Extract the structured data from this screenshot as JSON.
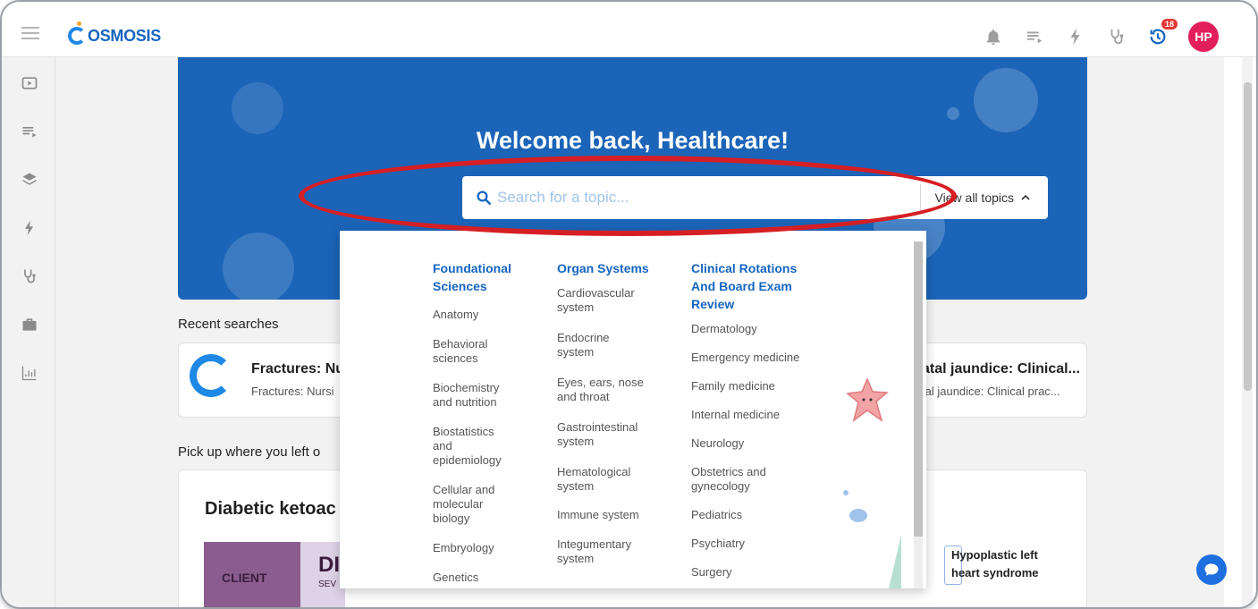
{
  "app": {
    "brand": "OSMOSIS",
    "user_initials": "HP",
    "history_badge": "18"
  },
  "hero": {
    "title": "Welcome back, Healthcare!",
    "search_placeholder": "Search for a topic...",
    "view_all_label": "View all topics"
  },
  "recent": {
    "label": "Recent searches",
    "items": [
      {
        "title": "Fractures: Nu",
        "subtitle": "Fractures: Nursi"
      },
      {
        "title": "atal jaundice: Clinical...",
        "subtitle": "tal jaundice: Clinical prac..."
      }
    ]
  },
  "continue": {
    "label": "Pick up where you left o",
    "card_title": "Diabetic ketoac",
    "side_title_line1": "Hypoplastic left",
    "side_title_line2": "heart syndrome",
    "thumb_text1": "CLIENT",
    "thumb_text2": "DI",
    "thumb_text3": "SEV"
  },
  "topics": {
    "columns": [
      {
        "heading_lines": [
          "Foundational",
          "Sciences"
        ],
        "items": [
          [
            "Anatomy"
          ],
          [
            "Behavioral",
            "sciences"
          ],
          [
            "Biochemistry",
            "and nutrition"
          ],
          [
            "Biostatistics",
            "and",
            "epidemiology"
          ],
          [
            "Cellular and",
            "molecular",
            "biology"
          ],
          [
            "Embryology"
          ],
          [
            "Genetics"
          ]
        ]
      },
      {
        "heading_lines": [
          "Organ Systems"
        ],
        "items": [
          [
            "Cardiovascular",
            "system"
          ],
          [
            "Endocrine",
            "system"
          ],
          [
            "Eyes, ears, nose",
            "and throat"
          ],
          [
            "Gastrointestinal",
            "system"
          ],
          [
            "Hematological",
            "system"
          ],
          [
            "Immune system"
          ],
          [
            "Integumentary",
            "system"
          ]
        ]
      },
      {
        "heading_lines": [
          "Clinical Rotations",
          "And Board Exam",
          "Review"
        ],
        "items": [
          [
            "Dermatology"
          ],
          [
            "Emergency medicine"
          ],
          [
            "Family medicine"
          ],
          [
            "Internal medicine"
          ],
          [
            "Neurology"
          ],
          [
            "Obstetrics and",
            "gynecology"
          ],
          [
            "Pediatrics"
          ],
          [
            "Psychiatry"
          ],
          [
            "Surgery"
          ]
        ]
      }
    ]
  },
  "icons": {
    "top": [
      "bell-icon",
      "playlist-icon",
      "flash-icon",
      "stethoscope-icon",
      "history-icon"
    ],
    "rail": [
      "video-icon",
      "playlist-icon",
      "layers-icon",
      "flash-icon",
      "stethoscope-icon",
      "briefcase-icon",
      "chart-icon"
    ]
  },
  "colors": {
    "brand_blue": "#1b64b8",
    "accent_blue": "#1565c0",
    "annotation_red": "#d61f24",
    "avatar_pink": "#e21f5a"
  }
}
